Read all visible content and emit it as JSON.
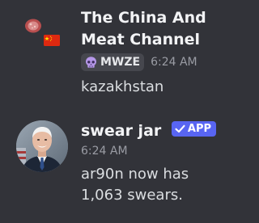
{
  "messages": [
    {
      "author": "The China And Meat Channel",
      "author_line1": "The China And",
      "author_line2": "Meat Channel",
      "role_icon": "skull-icon",
      "role_tag": "MWZE",
      "timestamp": "6:24 AM",
      "text": "kazakhstan",
      "avatar_icons": [
        "meat-icon",
        "china-flag-icon"
      ]
    },
    {
      "author": "swear jar",
      "app_badge": "APP",
      "app_badge_icon": "checkmark-icon",
      "timestamp": "6:24 AM",
      "text_line1": "ar90n now has",
      "text_line2": "1,063 swears.",
      "avatar": "portrait-avatar"
    }
  ],
  "colors": {
    "background": "#323339",
    "app_badge": "#5865f2",
    "author": "#f2f3f5",
    "text": "#dbdee1",
    "timestamp": "#9a9ca4"
  }
}
